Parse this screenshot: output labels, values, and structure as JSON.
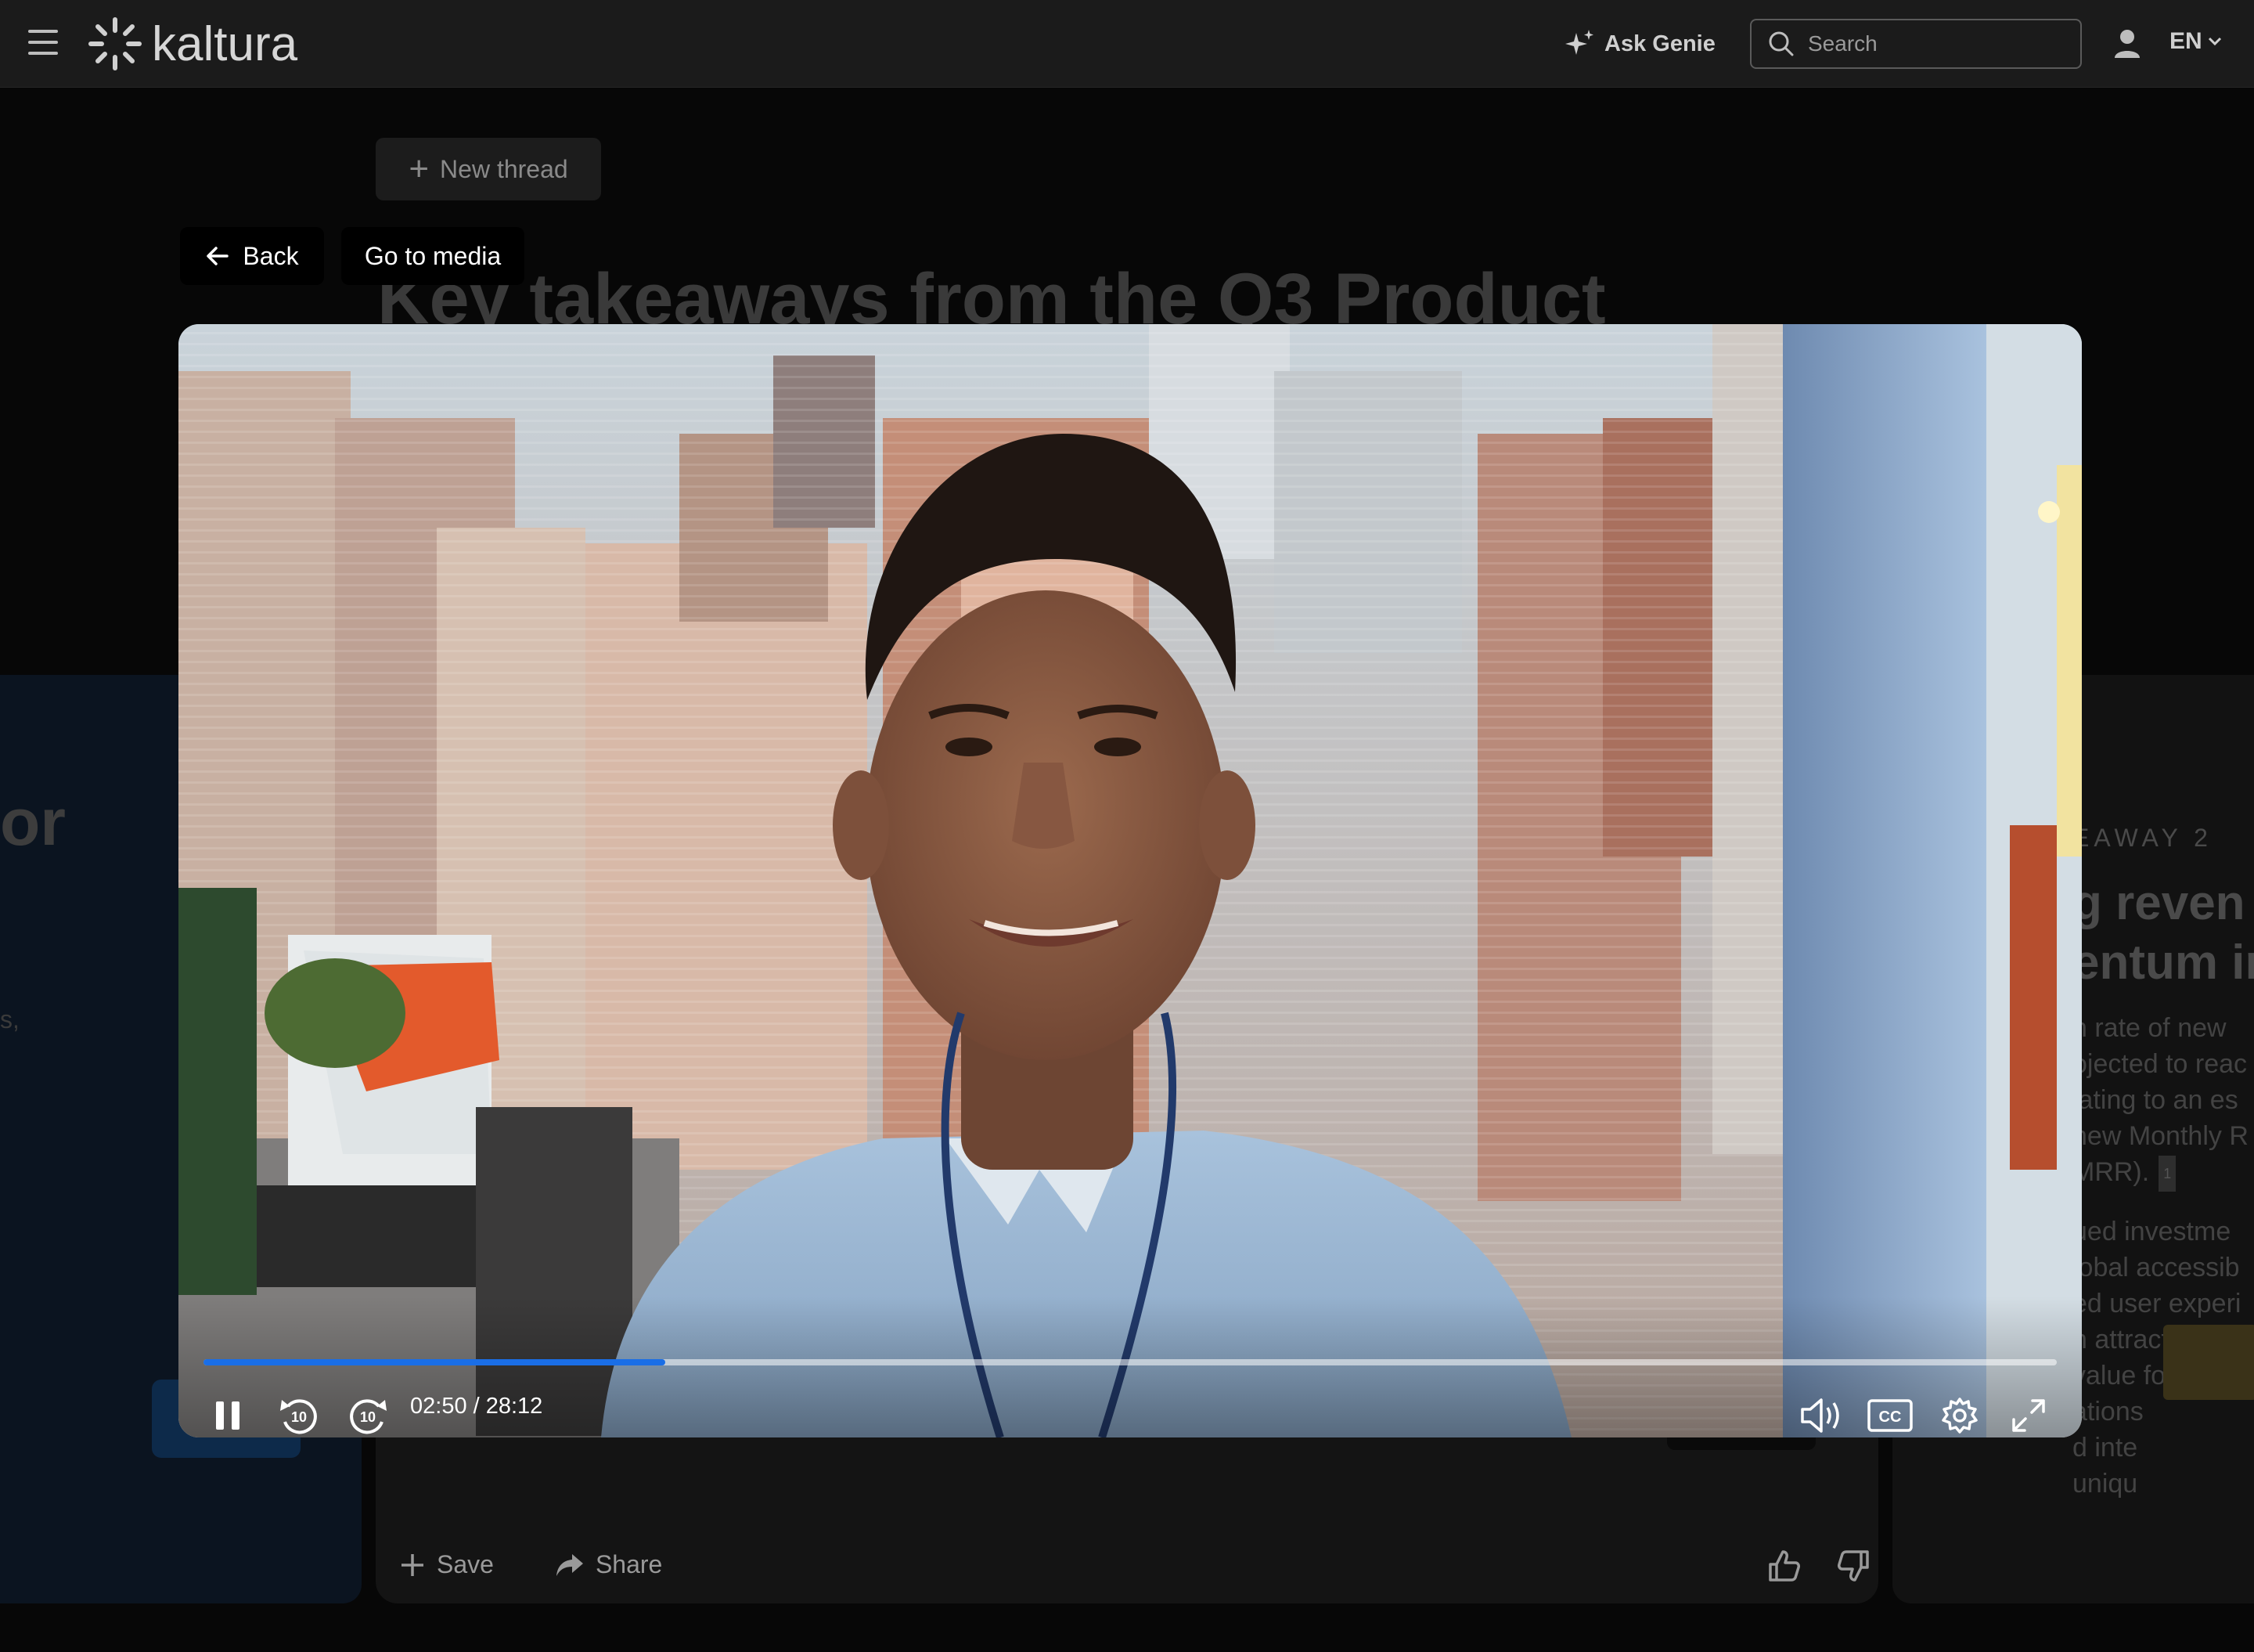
{
  "header": {
    "app_name": "kaltura",
    "ask_genie_label": "Ask Genie",
    "search_placeholder": "Search",
    "language": "EN"
  },
  "background_page": {
    "new_thread_label": "New thread",
    "title": "Key takeaways from the Q3 Product",
    "left_card": {
      "heading_fragment": "or",
      "text_fragment": "s,"
    },
    "right_card": {
      "label": "EAWAY 2",
      "heading_lines": [
        "g reven",
        "entum in"
      ],
      "paragraph_lines": [
        "h rate of new",
        "ojected to reac",
        "lating to an es",
        "new Monthly R",
        "MRR)."
      ],
      "citation": "1",
      "paragraph2_lines": [
        "ued investme",
        "lobal accessib",
        "ed user experi",
        "h attracting ne",
        "value for exis",
        "ations",
        "d inte",
        "uniqu"
      ]
    },
    "footer": {
      "save_label": "Save",
      "share_label": "Share"
    }
  },
  "modal": {
    "back_label": "Back",
    "go_to_media_label": "Go to media"
  },
  "player": {
    "current_time": "02:50",
    "duration": "28:12",
    "time_display": "02:50 / 28:12",
    "progress_fraction": 0.249,
    "state": "playing",
    "skip_seconds": "10",
    "cc_label": "CC",
    "accent_color": "#1a6ee6"
  }
}
